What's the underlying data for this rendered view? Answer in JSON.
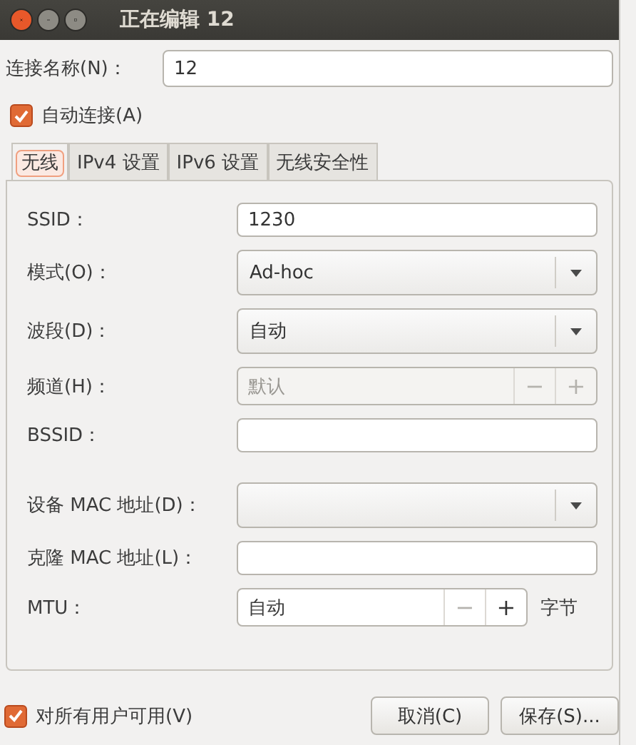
{
  "window": {
    "title": "正在编辑 12"
  },
  "connection_name": {
    "label": "连接名称(N)：",
    "value": "12"
  },
  "auto_connect": {
    "label": "自动连接(A)",
    "checked": true
  },
  "tabs": [
    {
      "label": "无线",
      "selected": true
    },
    {
      "label": "IPv4 设置",
      "selected": false
    },
    {
      "label": "IPv6 设置",
      "selected": false
    },
    {
      "label": "无线安全性",
      "selected": false
    }
  ],
  "fields": [
    {
      "kind": "entry",
      "label": "SSID：",
      "value": "1230"
    },
    {
      "kind": "combo",
      "label": "模式(O)：",
      "value": "Ad-hoc"
    },
    {
      "kind": "combo",
      "label": "波段(D)：",
      "value": "自动"
    },
    {
      "kind": "spin",
      "label": "频道(H)：",
      "value": "默认",
      "disabled": true,
      "minus": {
        "text": "−",
        "disabled": true
      },
      "plus": {
        "text": "+",
        "disabled": true
      }
    },
    {
      "kind": "entry",
      "label": "BSSID："
    },
    {
      "kind": "combo",
      "label": "设备 MAC 地址(D)："
    },
    {
      "kind": "entry",
      "label": "克隆 MAC 地址(L)："
    },
    {
      "kind": "spin",
      "label": "MTU：",
      "value": "自动",
      "disabled": false,
      "minus": {
        "text": "−",
        "disabled": true
      },
      "plus": {
        "text": "+",
        "disabled": false
      },
      "unit": "字节"
    }
  ],
  "all_users": {
    "label": "对所有用户可用(V)",
    "checked": true
  },
  "buttons": [
    "取消(C)",
    "保存(S)..."
  ]
}
